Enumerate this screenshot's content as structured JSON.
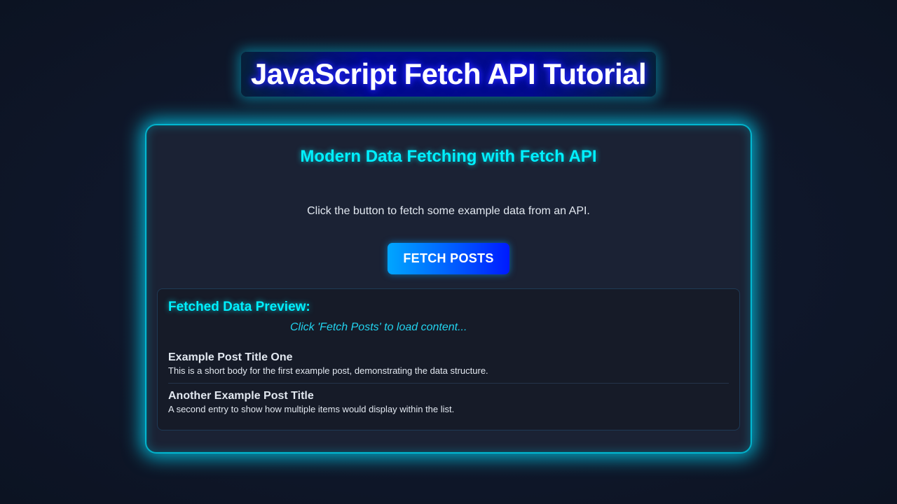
{
  "header": {
    "title": "JavaScript Fetch API Tutorial"
  },
  "card": {
    "heading": "Modern Data Fetching with Fetch API",
    "description": "Click the button to fetch some example data from an API.",
    "fetch_button_label": "FETCH POSTS"
  },
  "preview": {
    "title": "Fetched Data Preview:",
    "hint": "Click 'Fetch Posts' to load content...",
    "posts": [
      {
        "title": "Example Post Title One",
        "body": "This is a short body for the first example post, demonstrating the data structure."
      },
      {
        "title": "Another Example Post Title",
        "body": "A second entry to show how multiple items would display within the list."
      }
    ]
  },
  "colors": {
    "accent": "#00f0ff",
    "background": "#0f172a",
    "card": "#1b2234",
    "button_start": "#00a6ff",
    "button_end": "#001aff"
  }
}
